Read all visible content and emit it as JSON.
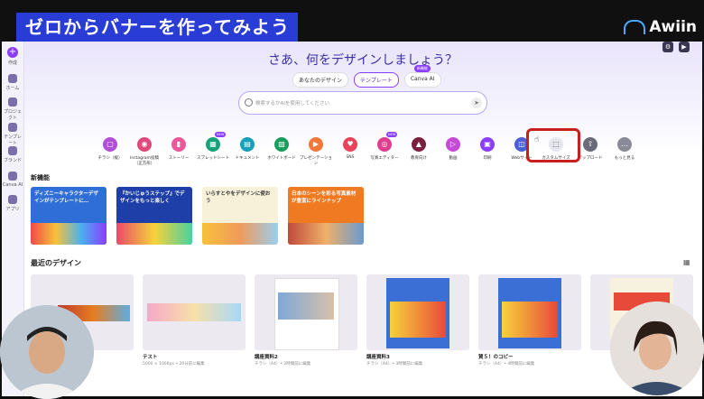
{
  "overlay": {
    "title": "ゼロからバナーを作ってみよう",
    "brand": "Awiin"
  },
  "sidebar": {
    "items": [
      {
        "label": "作成",
        "icon": "plus-icon"
      },
      {
        "label": "ホーム",
        "icon": "home-icon"
      },
      {
        "label": "プロジェクト",
        "icon": "folder-icon"
      },
      {
        "label": "テンプレート",
        "icon": "template-icon"
      },
      {
        "label": "ブランド",
        "icon": "brand-icon"
      },
      {
        "label": "Canva AI",
        "icon": "sparkle-icon"
      },
      {
        "label": "アプリ",
        "icon": "apps-icon"
      }
    ]
  },
  "hero": {
    "heading": "さあ、何をデザインしましょう？",
    "tabs": [
      {
        "label": "あなたのデザイン"
      },
      {
        "label": "テンプレート"
      },
      {
        "label": "Canva AI",
        "badge": "新機能"
      }
    ]
  },
  "search": {
    "placeholder": "検索するかAIを使用してください"
  },
  "categories": [
    {
      "label": "チラシ（縦）",
      "color": "#b14fd6"
    },
    {
      "label": "Instagram投稿（正方形）",
      "color": "#e04a7a"
    },
    {
      "label": "ストーリー",
      "color": "#e8589a"
    },
    {
      "label": "スプレッドシート",
      "color": "#16a37a",
      "badge": "NEW"
    },
    {
      "label": "ドキュメント",
      "color": "#17a0b8"
    },
    {
      "label": "ホワイトボード",
      "color": "#1a9e5c"
    },
    {
      "label": "プレゼンテーション",
      "color": "#f0783a"
    },
    {
      "label": "SNS",
      "color": "#e8435a"
    },
    {
      "label": "写真エディター",
      "color": "#e03d8f",
      "badge": "NEW"
    },
    {
      "label": "教育向け",
      "color": "#7a1f3d"
    },
    {
      "label": "動画",
      "color": "#c54bd6"
    },
    {
      "label": "印刷",
      "color": "#8b3dff"
    },
    {
      "label": "Webサイト",
      "color": "#4b5ed6"
    },
    {
      "label": "カスタムサイズ",
      "color": "#e6e6ee"
    },
    {
      "label": "アップロード",
      "color": "#6b6b7a"
    },
    {
      "label": "もっと見る",
      "color": "#8a8a99"
    }
  ],
  "new_section": {
    "title": "新機能",
    "banners": [
      {
        "text": "ディズニーキャラクターデザインがテンプレートに…",
        "color": "#2e6ed6"
      },
      {
        "text": "『かいじゅうステップ』でデザインをもっと楽しく",
        "color": "#1e3fa8"
      },
      {
        "text": "いらすとやをデザインに使おう",
        "color": "#f7f1d9"
      },
      {
        "text": "日本のシーンを彩る写真素材が豊富にラインナップ",
        "color": "#f07a22"
      }
    ]
  },
  "recent": {
    "title": "最近のデザイン",
    "designs": [
      {
        "title": "",
        "meta": ""
      },
      {
        "title": "テスト",
        "meta": "5000 × 1000px • 20分前に編集"
      },
      {
        "title": "講座資料2",
        "meta": "チラシ（A4）• 2時間前に編集"
      },
      {
        "title": "講座資料3",
        "meta": "チラシ（A4）• 3時間前に編集"
      },
      {
        "title": "賀５！のコピー",
        "meta": "チラシ（A4）• 4時間前に編集"
      },
      {
        "title": "",
        "meta": ""
      }
    ]
  }
}
